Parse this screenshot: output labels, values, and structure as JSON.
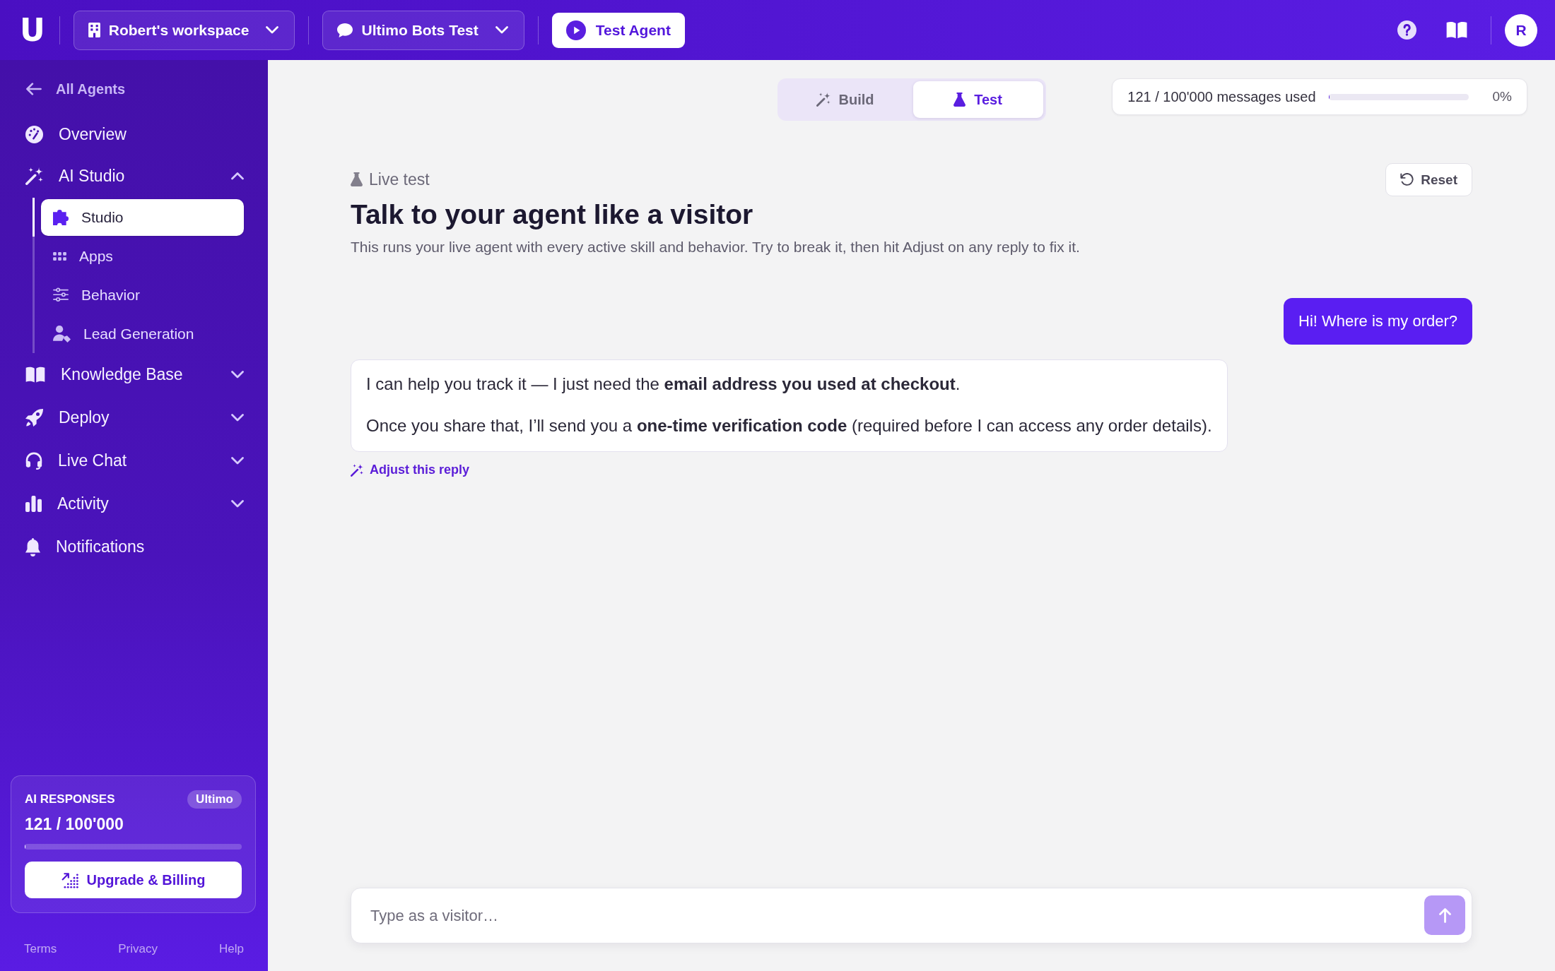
{
  "topbar": {
    "logo": "U",
    "workspace": "Robert's workspace",
    "project": "Ultimo Bots Test",
    "test_button": "Test Agent",
    "avatar": "R"
  },
  "sidebar": {
    "back_link": "All Agents",
    "items": [
      {
        "kind": "link",
        "label": "Overview",
        "selected": false
      },
      {
        "kind": "group",
        "label": "AI Studio",
        "selected": false,
        "expanded": true,
        "children": [
          {
            "label": "Studio",
            "selected": true
          },
          {
            "label": "Apps",
            "selected": false
          },
          {
            "label": "Behavior",
            "selected": false
          },
          {
            "label": "Lead Generation",
            "selected": false
          }
        ]
      },
      {
        "kind": "group",
        "label": "Knowledge Base",
        "selected": false,
        "expanded": false
      },
      {
        "kind": "group",
        "label": "Deploy",
        "selected": false,
        "expanded": false
      },
      {
        "kind": "group",
        "label": "Live Chat",
        "selected": false,
        "expanded": false
      },
      {
        "kind": "group",
        "label": "Activity",
        "selected": false,
        "expanded": false
      },
      {
        "kind": "link",
        "label": "Notifications",
        "selected": false
      }
    ],
    "usage_card": {
      "title": "AI RESPONSES",
      "plan": "Ultimo",
      "count": "121 / 100'000",
      "level": 0.0012,
      "button": "Upgrade & Billing"
    },
    "footer_links": [
      "Terms",
      "Privacy",
      "Help"
    ]
  },
  "mode_tabs": [
    {
      "label": "Build",
      "selected": false
    },
    {
      "label": "Test",
      "selected": true
    }
  ],
  "usage_meter": {
    "label": "121 / 100'000 messages used",
    "level": 0.0012,
    "reading": "0%"
  },
  "page_header": {
    "eyebrow": "Live test",
    "title": "Talk to your agent like a visitor",
    "description": "This runs your live agent with every active skill and behavior. Try to break it, then hit Adjust on any reply to fix it.",
    "reset_button": "Reset"
  },
  "messages": [
    {
      "kind": "visitor",
      "text": "Hi! Where is my order?"
    },
    {
      "kind": "agent",
      "paragraphs": [
        "I can help you track it — I just need the **email address you used at checkout**.",
        "Once you share that, I’ll send you a **one-time verification code** (required before I can access any order details)."
      ],
      "action": "Adjust this reply"
    }
  ],
  "composer": {
    "placeholder": "Type as a visitor…"
  }
}
